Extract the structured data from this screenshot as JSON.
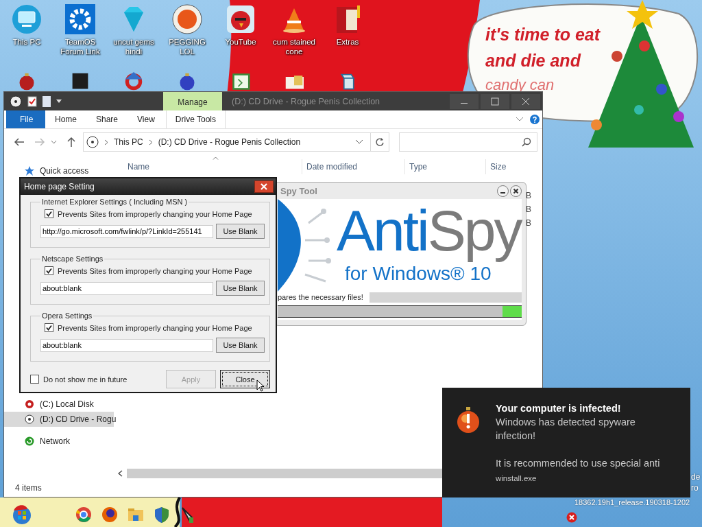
{
  "desktop": {
    "icons": [
      {
        "label": "This PC",
        "kind": "monitor"
      },
      {
        "label": "TeamOS Forum Link",
        "kind": "gear"
      },
      {
        "label": "uncut gems hindi",
        "kind": "gem"
      },
      {
        "label": "PEGGING LOL",
        "kind": "orange-logo"
      },
      {
        "label": "YouTube",
        "kind": "bird"
      },
      {
        "label": "cum stained cone",
        "kind": "cone"
      },
      {
        "label": "Extras",
        "kind": "book"
      }
    ],
    "icons_row_2": [
      {
        "kind": "ornament"
      },
      {
        "kind": "dark-box"
      },
      {
        "kind": "ring"
      },
      {
        "kind": "ball"
      },
      {
        "kind": "script"
      },
      {
        "kind": "card"
      },
      {
        "kind": "scroll"
      }
    ],
    "speech_bubble": [
      "it's time to eat",
      "and die and",
      "candy can"
    ],
    "corner_text": [
      "de",
      "ro",
      "18362.19h1_release.190318-1202"
    ]
  },
  "explorer": {
    "title": "(D:) CD Drive - Rogue Penis Collection",
    "context_tab": "Manage",
    "ribbon_tabs": [
      {
        "label": "File",
        "kind": "file"
      },
      {
        "label": "Home",
        "kind": "tab"
      },
      {
        "label": "Share",
        "kind": "tab"
      },
      {
        "label": "View",
        "kind": "tab"
      },
      {
        "label": "Drive Tools",
        "kind": "context"
      }
    ],
    "breadcrumb": [
      "This PC",
      "(D:) CD Drive - Rogue Penis Collection"
    ],
    "columns": [
      "Name",
      "Date modified",
      "Type",
      "Size"
    ],
    "sidebar": [
      {
        "label": "Quick access",
        "kind": "star",
        "selected": false
      },
      {
        "label": "(C:) Local Disk",
        "kind": "disk",
        "selected": false
      },
      {
        "label": "(D:) CD Drive - Rogu",
        "kind": "cd",
        "selected": true
      },
      {
        "label": "Network",
        "kind": "network",
        "selected": false
      }
    ],
    "file_sizes": [
      "B",
      "B",
      "B"
    ],
    "status_bar": "4 items"
  },
  "dialog": {
    "title": "Home page Setting",
    "groups": [
      {
        "title": "Internet Explorer Settings ( Including MSN )",
        "checkbox": {
          "label": "Prevents Sites from improperly changing your Home Page",
          "checked": true
        },
        "url": "http://go.microsoft.com/fwlink/p/?LinkId=255141",
        "button": "Use Blank"
      },
      {
        "title": "Netscape Settings",
        "checkbox": {
          "label": "Prevents Sites from improperly changing your Home Page",
          "checked": true
        },
        "url": "about:blank",
        "button": "Use Blank"
      },
      {
        "title": "Opera Settings",
        "checkbox": {
          "label": "Prevents Sites from improperly changing your Home Page",
          "checked": true
        },
        "url": "about:blank",
        "button": "Use Blank"
      }
    ],
    "footer_checkbox": {
      "label": "Do not show me in future",
      "checked": false
    },
    "buttons": [
      {
        "label": "Apply",
        "disabled": true,
        "focused": false
      },
      {
        "label": "Close",
        "disabled": false,
        "focused": true
      }
    ]
  },
  "antispy": {
    "title": "Spy Tool",
    "logo": [
      "Anti",
      "Spy"
    ],
    "subtitle": "for Windows® 10",
    "status": "pares the necessary files!",
    "progress": {
      "level": 0.92
    }
  },
  "notification": {
    "title": "Your computer is infected!",
    "body": "Windows has detected spyware infection!",
    "detail": "It is recommended to use special anti",
    "source": "winstall.exe"
  },
  "taskbar": [
    {
      "kind": "start"
    },
    {
      "kind": "browser"
    },
    {
      "kind": "globe"
    },
    {
      "kind": "folder"
    },
    {
      "kind": "shield"
    },
    {
      "kind": "pen"
    }
  ]
}
